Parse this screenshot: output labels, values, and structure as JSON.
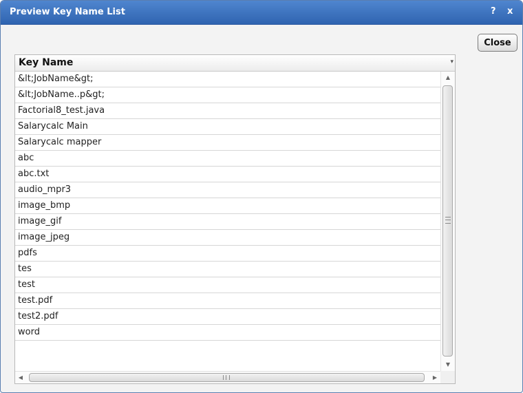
{
  "dialog": {
    "title": "Preview Key Name List",
    "help_label": "?",
    "close_x_label": "x",
    "close_button_label": "Close"
  },
  "grid": {
    "column_header": "Key Name",
    "rows": [
      "&lt;JobName&gt;",
      "&lt;JobName..p&gt;",
      "Factorial8_test.java",
      "Salarycalc Main",
      "Salarycalc mapper",
      "abc",
      "abc.txt",
      "audio_mpr3",
      "image_bmp",
      "image_gif",
      "image_jpeg",
      "pdfs",
      "tes",
      "test",
      "test.pdf",
      "test2.pdf",
      "word"
    ]
  }
}
